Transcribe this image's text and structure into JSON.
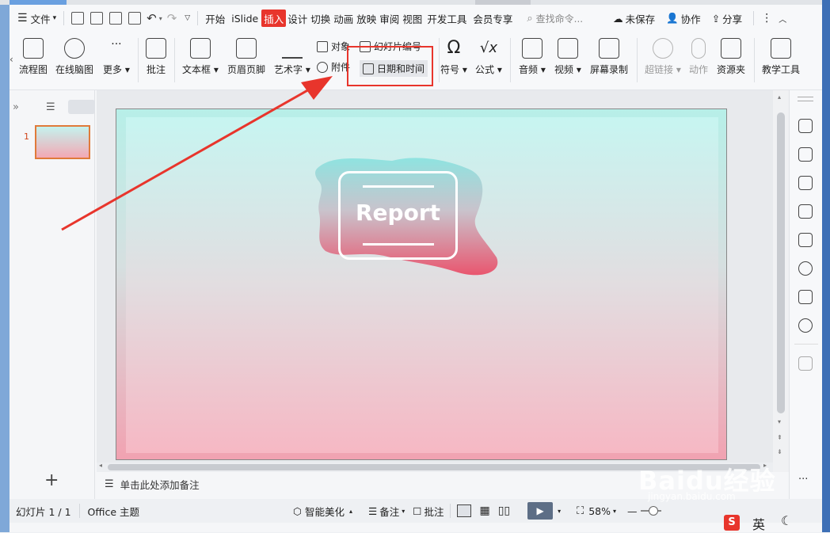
{
  "menu": {
    "file": "文件",
    "tabs": [
      "开始",
      "iSlide",
      "插入",
      "设计",
      "切换",
      "动画",
      "放映",
      "审阅",
      "视图",
      "开发工具",
      "会员专享"
    ],
    "search": "查找命令...",
    "unsaved": "未保存",
    "collab": "协作",
    "share": "分享"
  },
  "ribbon": {
    "flowchart": "流程图",
    "mindmap": "在线脑图",
    "more": "更多",
    "comment": "批注",
    "textbox": "文本框",
    "header_footer": "页眉页脚",
    "wordart": "艺术字",
    "object": "对象",
    "attachment": "附件",
    "slide_number": "幻灯片编号",
    "date_time": "日期和时间",
    "symbol": "符号",
    "formula": "公式",
    "audio": "音频",
    "video": "视频",
    "screen_record": "屏幕录制",
    "hyperlink": "超链接",
    "action": "动作",
    "resource": "资源夹",
    "teach": "教学工具"
  },
  "slide": {
    "number": "1",
    "title": "Report"
  },
  "notes_placeholder": "单击此处添加备注",
  "status": {
    "slide_count": "幻灯片 1 / 1",
    "theme": "Office 主题",
    "beautify": "智能美化",
    "notes": "备注",
    "comment": "批注",
    "zoom": "58%"
  },
  "tray": {
    "ime": "英"
  },
  "watermark": {
    "brand": "Baidu经验",
    "url": "jingyan.baidu.com"
  },
  "colors": {
    "accent": "#e8352c",
    "play": "#5d6e86"
  }
}
